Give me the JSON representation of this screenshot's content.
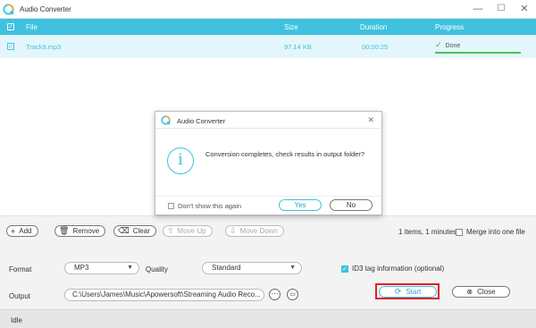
{
  "window": {
    "title": "Audio Converter",
    "minimize_icon": "minimize-icon",
    "maximize_icon": "maximize-icon",
    "close_icon": "close-icon"
  },
  "table": {
    "headers": {
      "file": "File",
      "size": "Size",
      "duration": "Duration",
      "progress": "Progress"
    },
    "rows": [
      {
        "file": "Track9.mp3",
        "size": "97.14 KB",
        "duration": "00:00:25",
        "progress_label": "Done",
        "progress_value": 1.0,
        "checked": true
      }
    ]
  },
  "toolbar": {
    "add_label": "Add",
    "remove_label": "Remove",
    "clear_label": "Clear",
    "move_up_label": "Move Up",
    "move_down_label": "Move Down",
    "items_info": "1 items, 1 minutes",
    "merge_label": "Merge into one file"
  },
  "settings": {
    "format_label": "Format",
    "format_value": "MP3",
    "quality_label": "Quality",
    "quality_value": "Standard",
    "id3_label": "ID3 tag information (optional)",
    "output_label": "Output",
    "output_path": "C:\\Users\\James\\Music\\Apowersoft\\Streaming Audio Reco...",
    "start_label": "Start",
    "close_label": "Close"
  },
  "status": {
    "text": "Idle"
  },
  "dialog": {
    "title": "Audio Converter",
    "message": "Conversion completes, check results in output folder?",
    "dont_show_label": "Don't show this again",
    "yes_label": "Yes",
    "no_label": "No"
  },
  "colors": {
    "accent": "#3ec2df",
    "row_highlight": "#e3f6fb",
    "progress_done": "#4cc25a",
    "highlight_outline": "#e02020"
  }
}
